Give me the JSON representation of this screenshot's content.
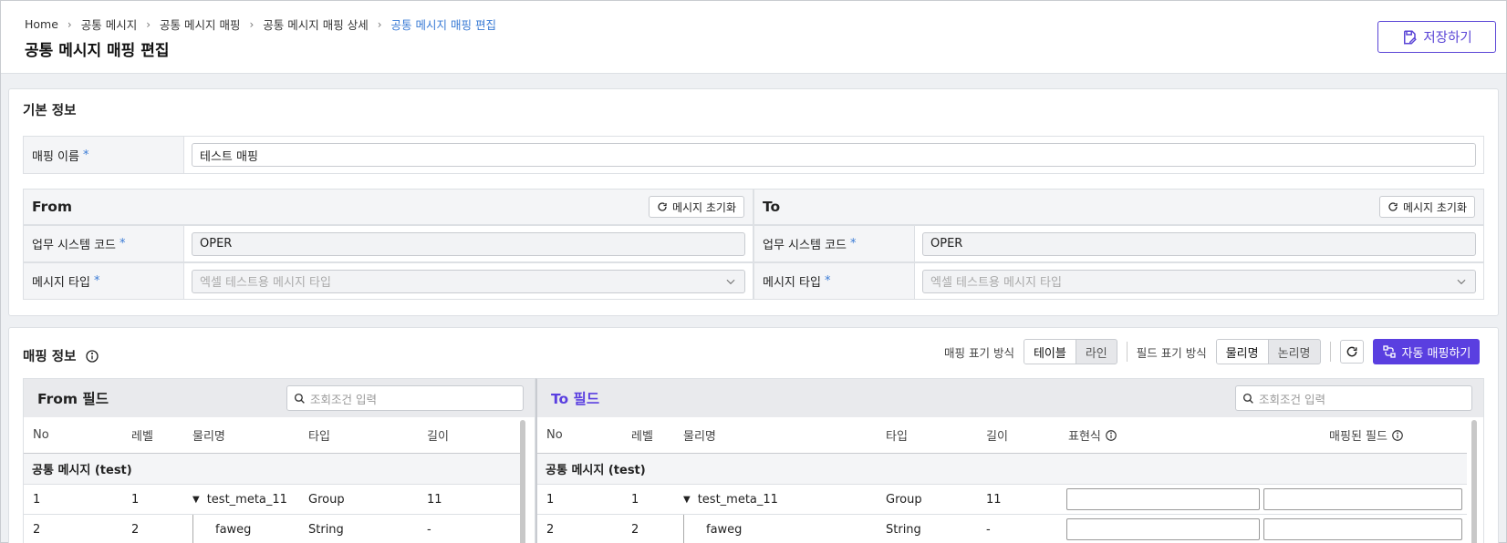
{
  "breadcrumb": {
    "items": [
      "Home",
      "공통 메시지",
      "공통 메시지 매핑",
      "공통 메시지 매핑 상세"
    ],
    "current": "공통 메시지 매핑 편집"
  },
  "header": {
    "title": "공통 메시지 매핑 편집",
    "save_label": "저장하기"
  },
  "basic": {
    "title": "기본 정보",
    "mapping_name_label": "매핑 이름",
    "mapping_name_value": "테스트 매핑",
    "required_mark": "*"
  },
  "from": {
    "title": "From",
    "reset_label": "메시지 초기화",
    "system_code_label": "업무 시스템 코드",
    "system_code_value": "OPER",
    "msg_type_label": "메시지 타입",
    "msg_type_placeholder": "엑셀 테스트용 메시지 타입"
  },
  "to": {
    "title": "To",
    "reset_label": "메시지 초기화",
    "system_code_label": "업무 시스템 코드",
    "system_code_value": "OPER",
    "msg_type_label": "메시지 타입",
    "msg_type_placeholder": "엑셀 테스트용 메시지 타입"
  },
  "mapping": {
    "title": "매핑 정보",
    "display_mode_label": "매핑 표기 방식",
    "display_mode_options": [
      "테이블",
      "라인"
    ],
    "field_mode_label": "필드 표기 방식",
    "field_mode_options": [
      "물리명",
      "논리명"
    ],
    "auto_label": "자동 매핑하기"
  },
  "from_fields": {
    "title": "From 필드",
    "search_placeholder": "조회조건 입력",
    "columns": [
      "No",
      "레벨",
      "물리명",
      "타입",
      "길이"
    ],
    "group": "공통 메시지 (test)",
    "rows": [
      {
        "no": "1",
        "level": "1",
        "name": "test_meta_11",
        "type": "Group",
        "length": "11",
        "caret": "▼"
      },
      {
        "no": "2",
        "level": "2",
        "name": "faweg",
        "type": "String",
        "length": "-"
      }
    ]
  },
  "to_fields": {
    "title": "To 필드",
    "search_placeholder": "조회조건 입력",
    "columns": [
      "No",
      "레벨",
      "물리명",
      "타입",
      "길이",
      "표현식",
      "매핑된 필드"
    ],
    "group": "공통 메시지 (test)",
    "rows": [
      {
        "no": "1",
        "level": "1",
        "name": "test_meta_11",
        "type": "Group",
        "length": "11",
        "caret": "▼"
      },
      {
        "no": "2",
        "level": "2",
        "name": "faweg",
        "type": "String",
        "length": "-"
      }
    ]
  },
  "colors": {
    "accent": "#5a3fe0",
    "link": "#3a7bd5"
  }
}
